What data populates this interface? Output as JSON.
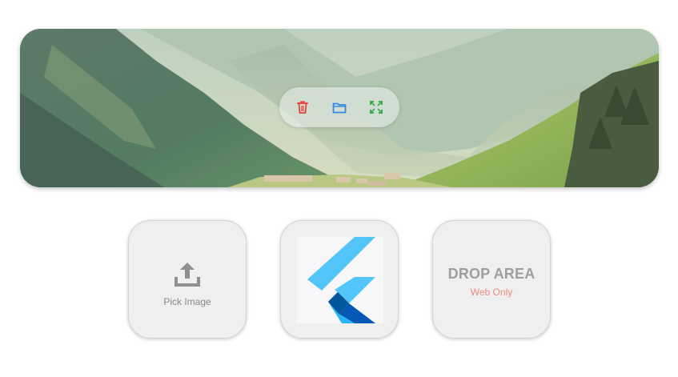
{
  "banner": {
    "image_alt": "mountain-valley-landscape",
    "toolbar": {
      "delete_icon": "trash-icon",
      "folder_icon": "folder-icon",
      "fullscreen_icon": "fullscreen-icon"
    }
  },
  "cards": {
    "pick": {
      "label": "Pick Image",
      "icon": "upload-icon"
    },
    "logo": {
      "icon": "flutter-logo-icon"
    },
    "drop": {
      "title": "DROP AREA",
      "subtitle": "Web Only"
    }
  },
  "colors": {
    "delete": "#e8433a",
    "folder": "#2e8ae6",
    "fullscreen": "#3fae4a",
    "flutter_light": "#47c5fb",
    "flutter_mid": "#00b5f8",
    "flutter_dark": "#0559b5"
  }
}
